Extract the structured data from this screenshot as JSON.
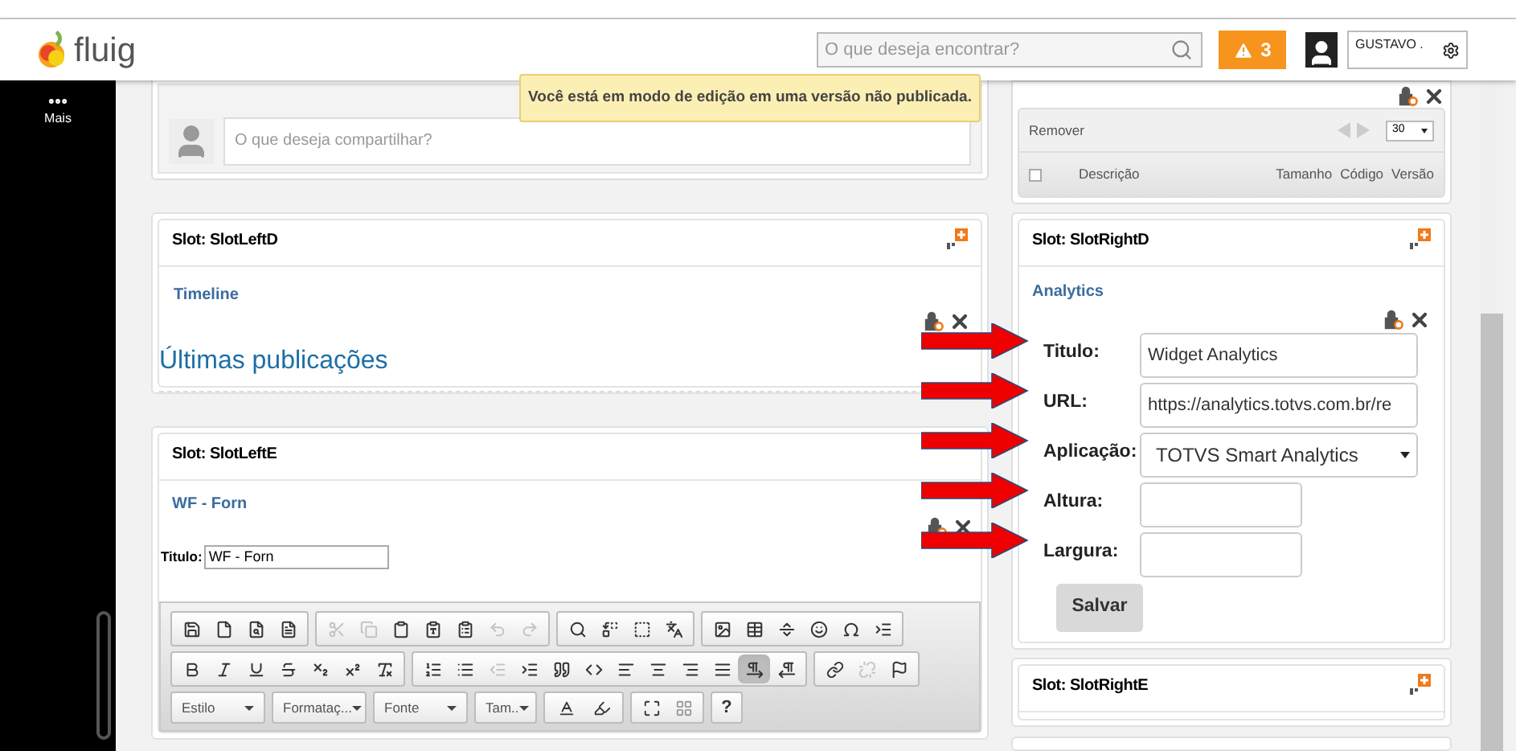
{
  "header": {
    "logo": "fluig",
    "search_placeholder": "O que deseja encontrar?",
    "alert_count": "3",
    "user": "GUSTAVO ."
  },
  "sidebar": {
    "items": [
      {
        "label": "Mais"
      }
    ]
  },
  "notice": "Você está em modo de edição em uma versão não publicada.",
  "left": {
    "share_placeholder": "O que deseja compartilhar?",
    "slots": [
      {
        "title": "Slot: SlotLeftD",
        "widget": "Timeline",
        "kind": "timeline",
        "add_icon": true,
        "heading": "Últimas publicações"
      },
      {
        "title": "Slot: SlotLeftE",
        "widget": "WF - Forn",
        "kind": "form",
        "add_icon": false,
        "field_label": "Titulo:",
        "field_value": "WF - Forn"
      }
    ]
  },
  "toolbar": {
    "rows": [
      [
        [
          {
            "disabled": false
          },
          {
            "disabled": false
          },
          {
            "disabled": false
          },
          {
            "disabled": false
          }
        ],
        [
          {
            "disabled": true
          },
          {
            "disabled": true
          },
          {
            "disabled": false
          },
          {
            "disabled": false
          },
          {
            "disabled": false
          },
          {
            "disabled": true
          },
          {
            "disabled": true
          }
        ],
        [
          {
            "disabled": false
          },
          {
            "disabled": false
          },
          {
            "disabled": false
          },
          {
            "disabled": false
          }
        ],
        [
          {
            "disabled": false
          },
          {
            "disabled": false
          },
          {
            "disabled": false
          },
          {
            "disabled": false
          },
          {
            "disabled": false
          },
          {
            "disabled": false
          }
        ]
      ],
      [
        [
          {
            "disabled": false
          },
          {
            "disabled": false
          },
          {
            "disabled": false
          },
          {
            "disabled": false
          },
          {
            "disabled": false
          },
          {
            "disabled": false
          },
          {
            "disabled": false
          }
        ],
        [
          {
            "disabled": false
          },
          {
            "disabled": false
          },
          {
            "disabled": true
          },
          {
            "disabled": false
          },
          {
            "disabled": false
          },
          {
            "disabled": false
          },
          {
            "disabled": false
          },
          {
            "disabled": false
          },
          {
            "disabled": false
          },
          {
            "disabled": false
          },
          {
            "disabled": false,
            "selected": true
          },
          {
            "disabled": false,
            "selected": false
          }
        ],
        [
          {
            "disabled": false
          },
          {
            "disabled": true
          },
          {
            "disabled": false
          }
        ]
      ]
    ],
    "combos": [
      "Estilo",
      "Formataç...",
      "Fonte",
      "Tam.."
    ],
    "help": "?"
  },
  "documents": {
    "remove": "Remover",
    "page_size": "30",
    "select_all_checked": false,
    "columns": [
      "Descrição",
      "Tamanho",
      "Código",
      "Versão"
    ]
  },
  "right": {
    "slots": [
      {
        "title": "Slot: SlotRightD",
        "widget": "Analytics",
        "kind": "form",
        "add_icon": true,
        "fields": [
          {
            "label": "Titulo:",
            "value": "Widget Analytics",
            "kind": "text",
            "arrow": true
          },
          {
            "label": "URL:",
            "value": "https://analytics.totvs.com.br/re",
            "kind": "text",
            "arrow": true
          },
          {
            "label": "Aplicação:",
            "value": "TOTVS Smart Analytics",
            "kind": "select",
            "arrow": true
          },
          {
            "label": "Altura:",
            "kind": "short",
            "arrow": true
          },
          {
            "label": "Largura:",
            "kind": "short",
            "arrow": true
          }
        ],
        "button": "Salvar"
      },
      {
        "title": "Slot: SlotRightE",
        "kind": "empty",
        "add_icon": true
      }
    ]
  }
}
